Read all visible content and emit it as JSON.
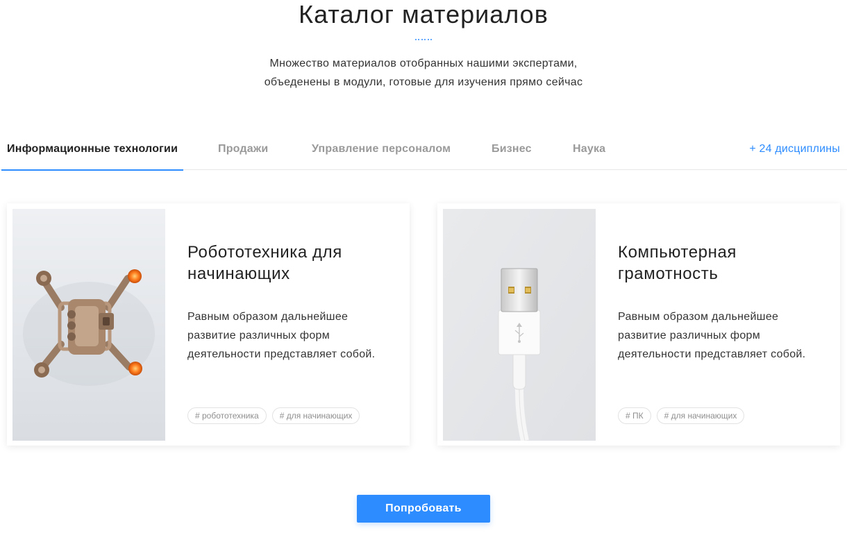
{
  "header": {
    "title": "Каталог материалов",
    "subtitle_line1": "Множество материалов отобранных нашими экспертами,",
    "subtitle_line2": "объеденены в модули, готовые для изучения прямо сейчас"
  },
  "tabs": [
    {
      "label": "Информационные технологии",
      "active": true
    },
    {
      "label": "Продажи",
      "active": false
    },
    {
      "label": "Управление персоналом",
      "active": false
    },
    {
      "label": "Бизнес",
      "active": false
    },
    {
      "label": "Наука",
      "active": false
    }
  ],
  "tabs_more": "+ 24 дисциплины",
  "cards": [
    {
      "title": "Робототехника для начинающих",
      "text": "Равным образом дальнейшее развитие различных форм деятельности представляет собой.",
      "image_icon": "drone-image",
      "tags": [
        "# робототехника",
        "# для начинающих"
      ]
    },
    {
      "title": "Компьютерная грамотность",
      "text": "Равным образом дальнейшее развитие различных форм деятельности представляет собой.",
      "image_icon": "usb-cable-image",
      "tags": [
        "# ПК",
        "# для начинающих"
      ]
    }
  ],
  "cta": {
    "label": "Попробовать"
  },
  "colors": {
    "accent": "#2d8cff",
    "text": "#222222",
    "muted": "#9a9a9a"
  }
}
